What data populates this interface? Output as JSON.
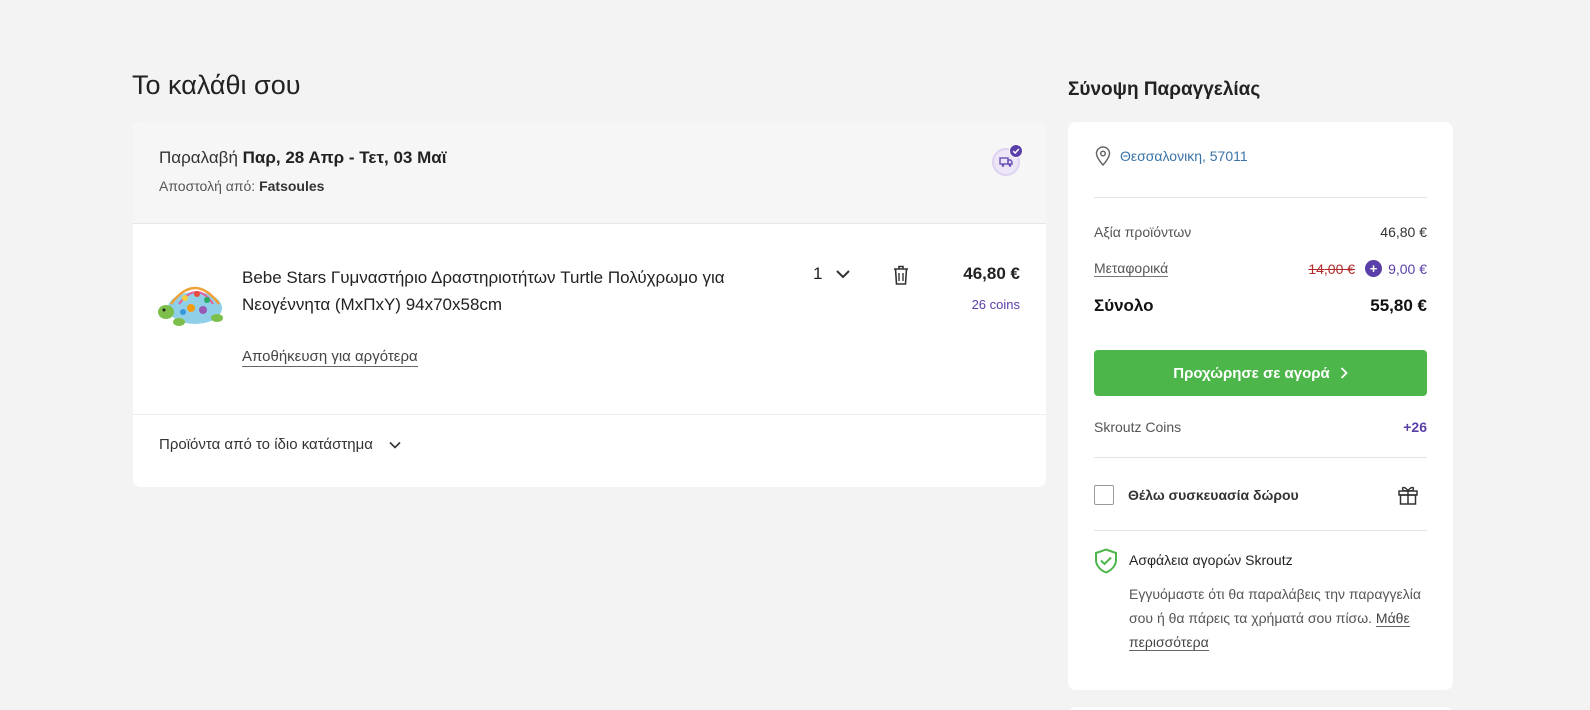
{
  "cart": {
    "title": "Το καλάθι σου",
    "delivery_prefix": "Παραλαβή ",
    "delivery_dates": "Παρ, 28 Απρ - Τετ, 03 Μαϊ",
    "shipper_prefix": "Αποστολή από: ",
    "shipper_name": "Fatsoules",
    "item": {
      "title": "Bebe Stars Γυμναστήριο Δραστηριοτήτων Turtle Πολύχρωμο για Νεογέννητα (ΜxΠxΥ) 94x70x58cm",
      "quantity": "1",
      "price": "46,80 €",
      "coins": "26 coins",
      "save_later": "Αποθήκευση για αργότερα"
    },
    "same_store": "Προϊόντα από το ίδιο κατάστημα"
  },
  "summary": {
    "title": "Σύνοψη Παραγγελίας",
    "location": "Θεσσαλονικη, 57011",
    "products_label": "Αξία προϊόντων",
    "products_value": "46,80 €",
    "shipping_label": "Μεταφορικά",
    "shipping_old": "14,00 €",
    "shipping_plus": "+",
    "shipping_new": "9,00 €",
    "total_label": "Σύνολο",
    "total_value": "55,80 €",
    "checkout_label": "Προχώρησε σε αγορά",
    "coins_label": "Skroutz Coins",
    "coins_value": "+26",
    "gift_label": "Θέλω συσκευασία δώρου",
    "safety_title": "Ασφάλεια αγορών Skroutz",
    "safety_text": "Εγγυόμαστε ότι θα παραλάβεις την παραγγελία σου ή θα πάρεις τα χρήματά σου πίσω. ",
    "learn_more": "Μάθε περισσότερα"
  },
  "colors": {
    "accent_purple": "#5b3fa8",
    "checkout_green": "#4db64a",
    "link_blue": "#3b73a8",
    "strike_red": "#b22a2a"
  }
}
